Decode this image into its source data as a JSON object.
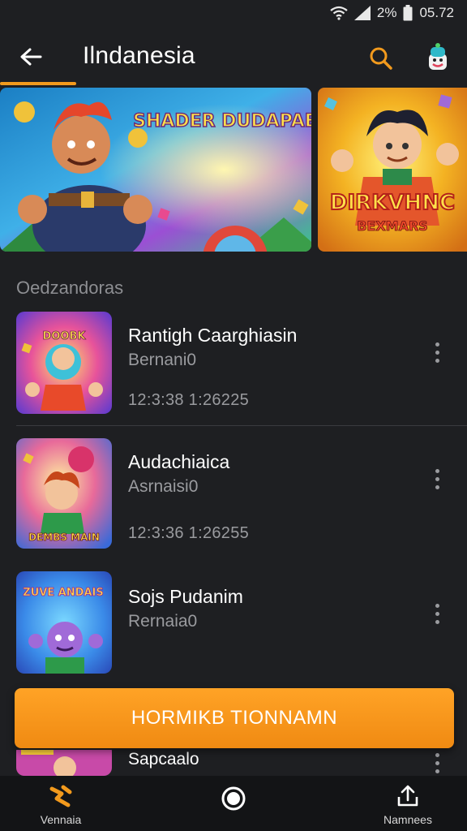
{
  "status_bar": {
    "battery": "2%",
    "time": "05.72"
  },
  "app": {
    "title": "Ilndanesia"
  },
  "icons": {
    "back": "back-arrow-icon",
    "search": "search-icon",
    "avatar": "character-avatar-icon",
    "more": "more-vertical-icon",
    "nav_home": "game-home-icon",
    "nav_record": "record-icon",
    "nav_share": "upload-share-icon"
  },
  "colors": {
    "accent": "#f29a1d",
    "background": "#1e1f22",
    "nav_background": "#131416"
  },
  "banners": [
    {
      "title": "SHADER DUDAPAEK"
    },
    {
      "title": "DIRKVHNC",
      "subtitle": "BEXMARS"
    }
  ],
  "section": {
    "title": "Oedzandoras"
  },
  "items": [
    {
      "title": "Rantigh Caarghiasin",
      "subtitle": "Bernani0",
      "time": "12:3:38 1:26225",
      "thumb_text": "DOOBK"
    },
    {
      "title": "Audachiaica",
      "subtitle": "Asrnaisi0",
      "time": "12:3:36 1:26255",
      "thumb_text": "DEMBS MAIN"
    },
    {
      "title": "Sojs Pudanim",
      "subtitle": "Rernaia0",
      "time": "",
      "thumb_text": "ZUVE ANDAIS"
    }
  ],
  "cta": {
    "label": "HORMIKB TIONNAMN"
  },
  "peek_item": {
    "title": "Sapcaalo"
  },
  "bottom_nav": [
    {
      "label": "Vennaia"
    },
    {
      "label": ""
    },
    {
      "label": "Namnees"
    }
  ]
}
